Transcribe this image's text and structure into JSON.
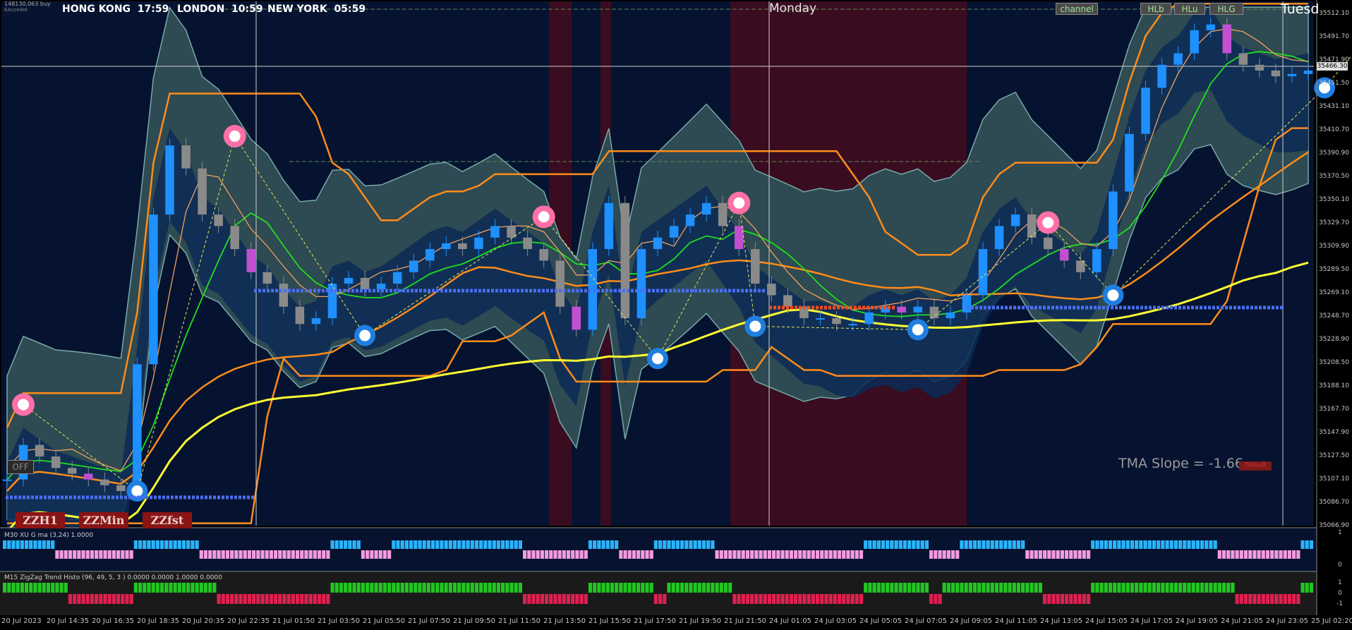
{
  "top_ticker": "148130,063 buy",
  "account_label": "EAcoedet",
  "sessions": [
    {
      "label": "HONG KONG  17:59",
      "bg": "#8a1414"
    },
    {
      "label": "LONDON  10:59",
      "bg": "#1f6fd0"
    },
    {
      "label": "NEW YORK  05:59",
      "bg": "#8a1414"
    }
  ],
  "day_labels": [
    "Monday",
    "Tuesd"
  ],
  "top_buttons": [
    "channel",
    "HLb",
    "HLu",
    "HLG"
  ],
  "zz_buttons": [
    "ZZH1",
    "ZZMin",
    "ZZfst"
  ],
  "off_label": "OFF",
  "tma_slope": "TMA Slope = -1.66",
  "tma_badge": "TMAoff",
  "current_price": "35466.30",
  "indicator1_label": "M30 XU G ma (3,24) 1.0000",
  "indicator2_label": "M15 ZigZag Trend Histo (96, 49, 5, 3 ) 0.0000 0.0000 1.0000 0.0000",
  "ind1_scale": [
    "1",
    "0"
  ],
  "ind2_scale": [
    "1",
    "0",
    "-1"
  ],
  "colors": {
    "bg": "#061330",
    "band": "#2e4a52",
    "session_red": "#3a0c20",
    "bull": "#1e90ff",
    "bear": "#8a8a8a",
    "orange": "#ff8c1a",
    "yellow": "#ffff33",
    "green": "#1ee01e",
    "pink_top": "#ff6fa8",
    "blue_bottom": "#1e7fe0",
    "magenta": "#c050d0"
  },
  "chart_data": {
    "type": "line",
    "title": "",
    "y_ticks": [
      "35512.10",
      "35491.70",
      "35471.90",
      "35451.50",
      "35431.10",
      "35410.70",
      "35390.90",
      "35370.50",
      "35350.10",
      "35329.70",
      "35309.90",
      "35289.50",
      "35269.10",
      "35248.70",
      "35228.90",
      "35208.50",
      "35188.10",
      "35167.70",
      "35147.90",
      "35127.50",
      "35107.10",
      "35086.70",
      "35066.90"
    ],
    "x_ticks": [
      "20 Jul 2023",
      "20 Jul 14:35",
      "20 Jul 16:35",
      "20 Jul 18:35",
      "20 Jul 20:35",
      "20 Jul 22:35",
      "21 Jul 01:50",
      "21 Jul 03:50",
      "21 Jul 05:50",
      "21 Jul 07:50",
      "21 Jul 09:50",
      "21 Jul 11:50",
      "21 Jul 13:50",
      "21 Jul 15:50",
      "21 Jul 17:50",
      "21 Jul 19:50",
      "21 Jul 21:50",
      "24 Jul 01:05",
      "24 Jul 03:05",
      "24 Jul 05:05",
      "24 Jul 07:05",
      "24 Jul 09:05",
      "24 Jul 11:05",
      "24 Jul 13:05",
      "24 Jul 15:05",
      "24 Jul 17:05",
      "24 Jul 19:05",
      "24 Jul 21:05",
      "24 Jul 23:05",
      "25 Jul 02:20"
    ],
    "ylim": [
      35060,
      35515
    ],
    "close": [
      35100,
      35130,
      35120,
      35110,
      35105,
      35100,
      35095,
      35090,
      35200,
      35330,
      35390,
      35370,
      35330,
      35320,
      35300,
      35280,
      35270,
      35250,
      35235,
      35240,
      35270,
      35275,
      35265,
      35270,
      35280,
      35290,
      35300,
      35305,
      35300,
      35310,
      35320,
      35310,
      35300,
      35290,
      35250,
      35230,
      35300,
      35340,
      35240,
      35300,
      35310,
      35320,
      35330,
      35340,
      35320,
      35300,
      35270,
      35260,
      35250,
      35240,
      35240,
      35235,
      35235,
      35245,
      35250,
      35245,
      35250,
      35240,
      35245,
      35260,
      35300,
      35320,
      35330,
      35310,
      35300,
      35290,
      35280,
      35300,
      35350,
      35400,
      35440,
      35460,
      35470,
      35490,
      35495,
      35470,
      35460,
      35455,
      35450,
      35452,
      35455
    ],
    "zigzag_highs": [
      [
        1,
        35165
      ],
      [
        14,
        35398
      ],
      [
        33,
        35328
      ],
      [
        45,
        35340
      ],
      [
        64,
        35323
      ],
      [
        85,
        35507
      ]
    ],
    "zigzag_lows": [
      [
        8,
        35090
      ],
      [
        22,
        35225
      ],
      [
        40,
        35205
      ],
      [
        46,
        35233
      ],
      [
        56,
        35230
      ],
      [
        68,
        35260
      ],
      [
        81,
        35440
      ]
    ]
  }
}
